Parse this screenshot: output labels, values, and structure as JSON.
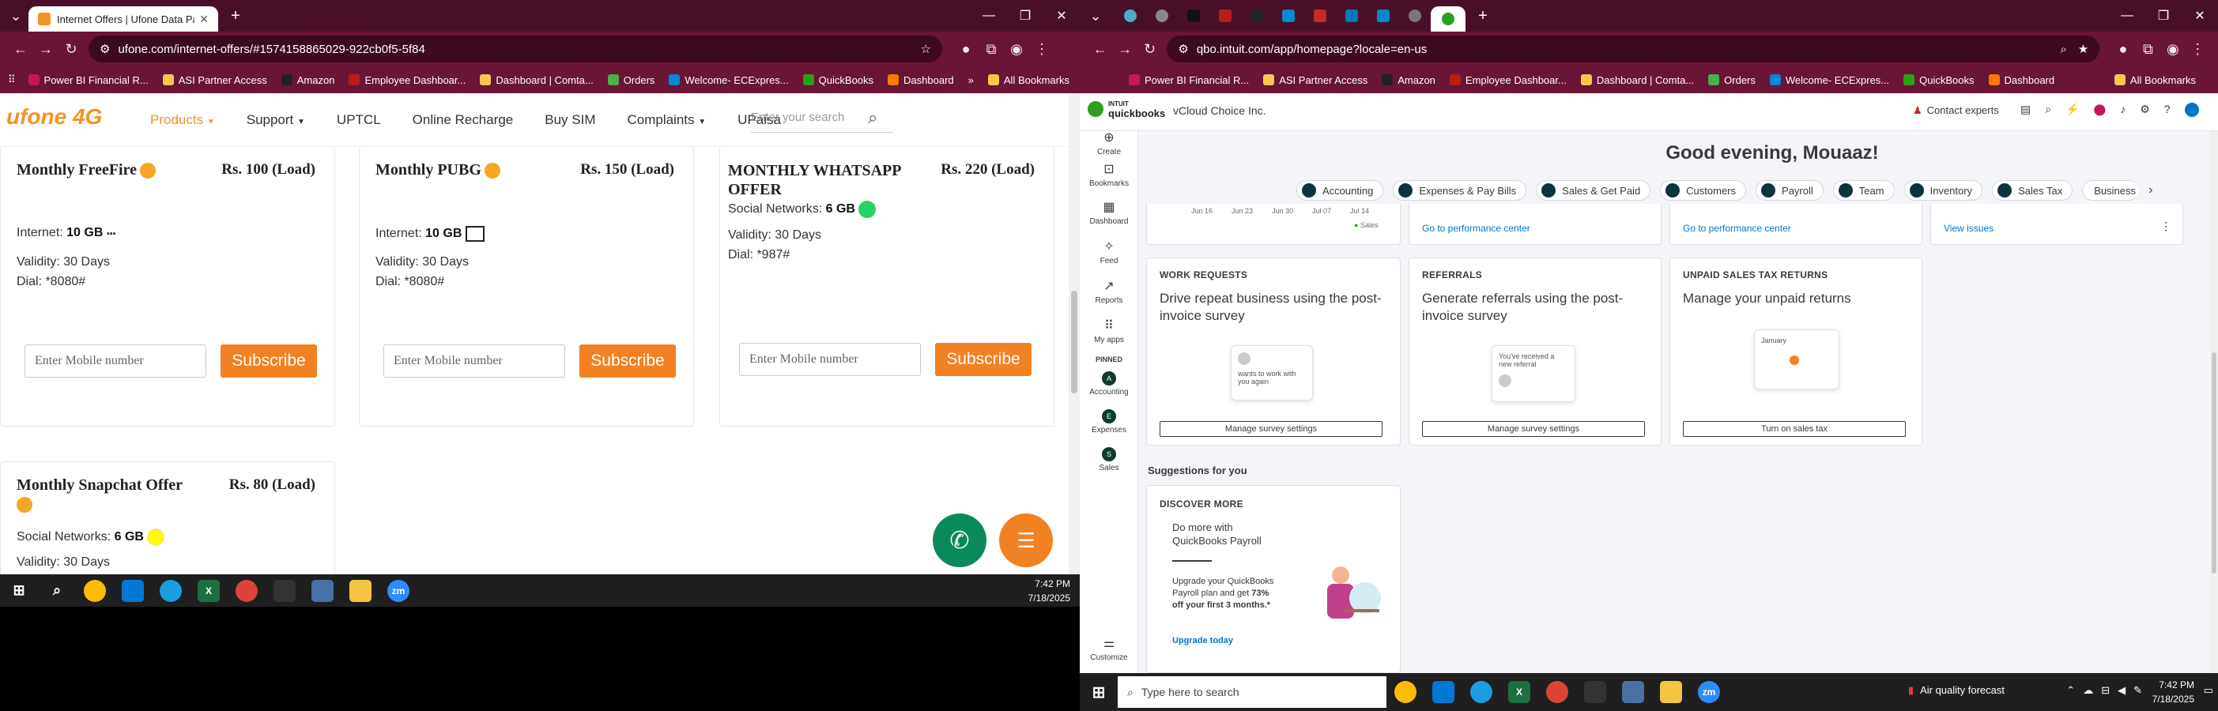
{
  "left": {
    "tab": {
      "title": "Internet Offers | Ufone Data Pa"
    },
    "url": "ufone.com/internet-offers/#1574158865029-922cb0f5-5f84",
    "bookmarks": [
      "Power BI Financial R...",
      "ASI Partner Access",
      "Amazon",
      "Employee Dashboar...",
      "Dashboard | Comta...",
      "Orders",
      "Welcome- ECExpres...",
      "QuickBooks",
      "Dashboard"
    ],
    "all_bookmarks": "All Bookmarks",
    "site": {
      "logo": "ufone 4G",
      "nav": [
        "Products",
        "Support",
        "UPTCL",
        "Online Recharge",
        "Buy SIM",
        "Complaints",
        "UPaisa"
      ],
      "search_placeholder": "Enter your search",
      "cards": [
        {
          "title": "Monthly FreeFire",
          "price": "Rs. 100 (Load)",
          "line1_label": "Internet:",
          "line1_value": "10 GB",
          "validity": "Validity: 30 Days",
          "dial": "Dial: *8080#",
          "placeholder": "Enter Mobile number",
          "button": "Subscribe"
        },
        {
          "title": "Monthly PUBG",
          "price": "Rs. 150 (Load)",
          "line1_label": "Internet:",
          "line1_value": "10 GB",
          "validity": "Validity: 30 Days",
          "dial": "Dial: *8080#",
          "placeholder": "Enter Mobile number",
          "button": "Subscribe"
        },
        {
          "title": "MONTHLY WHATSAPP OFFER",
          "price": "Rs. 220 (Load)",
          "line1_label": "Social Networks:",
          "line1_value": "6 GB",
          "validity": "Validity: 30 Days",
          "dial": "Dial: *987#",
          "placeholder": "Enter Mobile number",
          "button": "Subscribe"
        },
        {
          "title": "Monthly Snapchat Offer",
          "price": "Rs. 80 (Load)",
          "line1_label": "Social Networks:",
          "line1_value": "6 GB",
          "validity": "Validity: 30 Days"
        }
      ]
    },
    "taskbar": {
      "time": "7:42 PM",
      "date": "7/18/2025"
    }
  },
  "right": {
    "url": "qbo.intuit.com/app/homepage?locale=en-us",
    "bookmarks": [
      "Power BI Financial R...",
      "ASI Partner Access",
      "Amazon",
      "Employee Dashboar...",
      "Dashboard | Comta...",
      "Orders",
      "Welcome- ECExpres...",
      "QuickBooks",
      "Dashboard"
    ],
    "all_bookmarks": "All Bookmarks",
    "qb": {
      "brand_top": "INTUIT",
      "brand": "quickbooks",
      "company": "vCloud Choice Inc.",
      "contact": "Contact experts",
      "greeting": "Good evening, Mouaaz!",
      "pills": [
        "Accounting",
        "Expenses & Pay Bills",
        "Sales & Get Paid",
        "Customers",
        "Payroll",
        "Team",
        "Inventory",
        "Sales Tax",
        "Business"
      ],
      "side": [
        {
          "label": "Create",
          "icon": "⊕"
        },
        {
          "label": "Bookmarks",
          "icon": "⊡"
        },
        {
          "label": "Dashboard",
          "icon": "▦"
        },
        {
          "label": "Feed",
          "icon": "✧"
        },
        {
          "label": "Reports",
          "icon": "↗"
        },
        {
          "label": "My apps",
          "icon": "⠿"
        }
      ],
      "pinned_label": "PINNED",
      "pinned": [
        "Accounting",
        "Expenses",
        "Sales"
      ],
      "customize": "Customize",
      "chart_dates": [
        "Jun 16",
        "Jun 23",
        "Jun 30",
        "Jul 07",
        "Jul 14"
      ],
      "chart_legend": "Sales",
      "perf_link1": "Go to performance center",
      "perf_link2": "Go to performance center",
      "view_issues": "View issues",
      "cards": [
        {
          "label": "WORK REQUESTS",
          "title": "Drive repeat business using the post-invoice survey",
          "illus": "wants to work with you again",
          "button": "Manage survey settings"
        },
        {
          "label": "REFERRALS",
          "title": "Generate referrals using the post-invoice survey",
          "illus": "You've received a new referral",
          "button": "Manage survey settings"
        },
        {
          "label": "UNPAID SALES TAX RETURNS",
          "title": "Manage your unpaid returns",
          "illus": "January",
          "button": "Turn on sales tax"
        }
      ],
      "suggestions": "Suggestions for you",
      "discover": {
        "label": "DISCOVER MORE",
        "title": "Do more with QuickBooks Payroll",
        "body1": "Upgrade your QuickBooks Payroll plan and get",
        "body_bold": "73% off your first 3 months.*",
        "link": "Upgrade today"
      }
    },
    "taskbar": {
      "search": "Type here to search",
      "weather": "Air quality forecast",
      "time": "7:42 PM",
      "date": "7/18/2025"
    }
  }
}
